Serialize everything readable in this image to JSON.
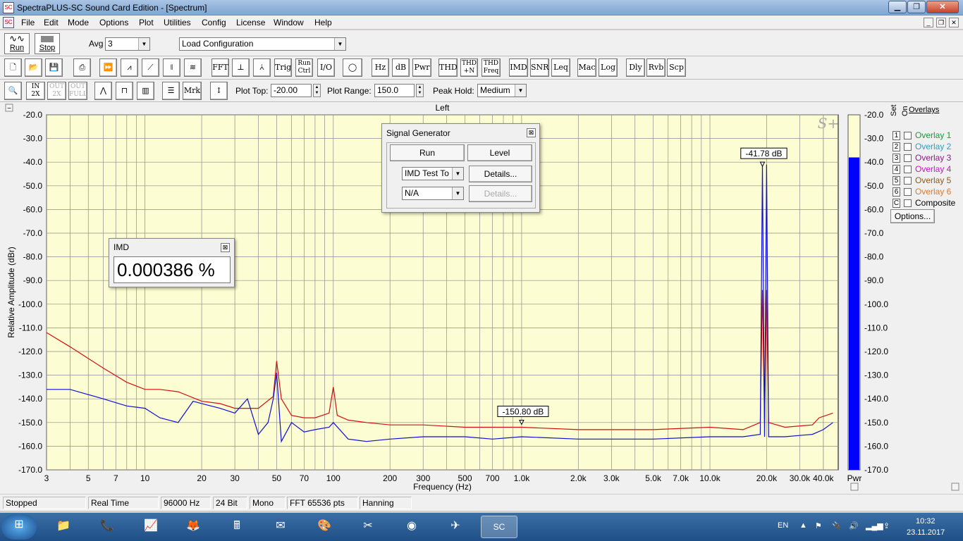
{
  "window": {
    "title": "SpectraPLUS-SC Sound Card Edition - [Spectrum]",
    "app_icon": "spectraplus-icon",
    "controls": [
      "minimize",
      "restore",
      "close"
    ]
  },
  "menu": {
    "items": [
      "File",
      "Edit",
      "Mode",
      "Options",
      "Plot",
      "Utilities",
      "Config",
      "License",
      "Window",
      "Help"
    ]
  },
  "toolbar1": {
    "run_label": "Run",
    "stop_label": "Stop",
    "avg_label": "Avg",
    "avg_value": "3",
    "config_value": "Load Configuration"
  },
  "toolbar2": {
    "buttons": [
      "FFT",
      "Trig",
      "Run Ctrl",
      "I/O",
      "Hz",
      "dB",
      "Pwr",
      "THD",
      "THD +N",
      "THD Freq",
      "IMD",
      "SNR",
      "Leq",
      "Mac",
      "Log",
      "Dly",
      "Rvb",
      "Scp"
    ]
  },
  "toolbar3": {
    "zoom_in": "IN 2X",
    "zoom_out": "OUT 2X",
    "zoom_full": "OUT FULL",
    "mrk": "Mrk",
    "plot_top_label": "Plot Top:",
    "plot_top_value": "-20.00",
    "plot_range_label": "Plot Range:",
    "plot_range_value": "150.0",
    "peak_hold_label": "Peak Hold:",
    "peak_hold_value": "Medium"
  },
  "plot": {
    "channel_title": "Left",
    "logo": "S+",
    "marker1": "-41.78 dB",
    "marker2": "-150.80 dB",
    "pwr_label": "Pwr"
  },
  "chart_data": {
    "type": "line",
    "title": "Left",
    "xlabel": "Frequency (Hz)",
    "ylabel": "Relative Amplitude (dBr)",
    "xscale": "log",
    "xlim": [
      3,
      48000
    ],
    "ylim": [
      -170,
      -20
    ],
    "x_tick_labels": [
      "3",
      "5",
      "7",
      "10",
      "20",
      "30",
      "50",
      "70",
      "100",
      "200",
      "300",
      "500",
      "700",
      "1.0k",
      "2.0k",
      "3.0k",
      "5.0k",
      "7.0k",
      "10.0k",
      "20.0k",
      "30.0k",
      "40.0k"
    ],
    "x_tick_values": [
      3,
      5,
      7,
      10,
      20,
      30,
      50,
      70,
      100,
      200,
      300,
      500,
      700,
      1000,
      2000,
      3000,
      5000,
      7000,
      10000,
      20000,
      30000,
      40000
    ],
    "y_tick_labels": [
      "-20.0",
      "-30.0",
      "-40.0",
      "-50.0",
      "-60.0",
      "-70.0",
      "-80.0",
      "-90.0",
      "-100.0",
      "-110.0",
      "-120.0",
      "-130.0",
      "-140.0",
      "-150.0",
      "-160.0",
      "-170.0"
    ],
    "grid": true,
    "series": [
      {
        "color": "#d01010",
        "x": [
          3,
          4,
          6,
          8,
          10,
          12,
          15,
          20,
          25,
          30,
          40,
          48,
          50,
          53,
          60,
          70,
          80,
          95,
          100,
          105,
          120,
          150,
          200,
          300,
          500,
          700,
          1000,
          2000,
          3000,
          5000,
          10000,
          15000,
          18500,
          19000,
          19500,
          20000,
          20500,
          25000,
          35000,
          38000,
          45000
        ],
        "y": [
          -112,
          -118,
          -127,
          -133,
          -136,
          -136,
          -137,
          -141,
          -142,
          -144,
          -144,
          -139,
          -124,
          -140,
          -147,
          -148,
          -148,
          -146,
          -135,
          -147,
          -149,
          -150,
          -151,
          -151,
          -152,
          -152,
          -152,
          -153,
          -153,
          -153,
          -152,
          -153,
          -150,
          -94,
          -150,
          -94,
          -150,
          -152,
          -151,
          -148,
          -146
        ]
      },
      {
        "color": "#1010d0",
        "x": [
          3,
          4,
          6,
          8,
          10,
          12,
          15,
          18,
          20,
          25,
          30,
          35,
          40,
          45,
          48,
          50,
          53,
          60,
          70,
          80,
          95,
          100,
          120,
          150,
          200,
          300,
          500,
          700,
          1000,
          2000,
          3000,
          5000,
          10000,
          15000,
          18500,
          19000,
          19500,
          20000,
          20500,
          25000,
          35000,
          40000,
          45000
        ],
        "y": [
          -136,
          -136,
          -140,
          -143,
          -144,
          -148,
          -150,
          -141,
          -142,
          -144,
          -146,
          -140,
          -155,
          -150,
          -140,
          -129,
          -158,
          -150,
          -154,
          -153,
          -152,
          -150,
          -157,
          -158,
          -157,
          -156,
          -156,
          -157,
          -156,
          -157,
          -157,
          -157,
          -156,
          -156,
          -155,
          -41,
          -156,
          -41,
          -156,
          -156,
          -155,
          -153,
          -150
        ]
      }
    ]
  },
  "pwr_meter": {
    "labels": [
      "-20.0",
      "-30.0",
      "-40.0",
      "-50.0",
      "-60.0",
      "-70.0",
      "-80.0",
      "-90.0",
      "-100.0",
      "-110.0",
      "-120.0",
      "-130.0",
      "-140.0",
      "-150.0",
      "-160.0",
      "-170.0"
    ],
    "level_db": -38
  },
  "overlays": {
    "title": "Overlays",
    "set_label": "Set",
    "on_label": "On",
    "items": [
      {
        "num": "1",
        "name": "Overlay 1",
        "color": "#1a9a3a"
      },
      {
        "num": "2",
        "name": "Overlay 2",
        "color": "#2aa0c0"
      },
      {
        "num": "3",
        "name": "Overlay 3",
        "color": "#8a1a8a"
      },
      {
        "num": "4",
        "name": "Overlay 4",
        "color": "#d010d0"
      },
      {
        "num": "5",
        "name": "Overlay 5",
        "color": "#8a5a1a"
      },
      {
        "num": "6",
        "name": "Overlay 6",
        "color": "#e07a2a"
      },
      {
        "num": "C",
        "name": "Composite",
        "color": "#000000"
      }
    ],
    "options_label": "Options..."
  },
  "imd_dialog": {
    "title": "IMD",
    "value": "0.000386 %"
  },
  "siggen_dialog": {
    "title": "Signal Generator",
    "run_label": "Run",
    "level_label": "Level",
    "mode_value": "IMD Test To",
    "details1_label": "Details...",
    "na_value": "N/A",
    "details2_label": "Details..."
  },
  "status": {
    "cells": [
      "Stopped",
      "Real Time",
      "96000 Hz",
      "24 Bit",
      "Mono",
      "FFT 65536 pts",
      "Hanning"
    ]
  },
  "taskbar": {
    "lang": "EN",
    "time": "10:32",
    "date": "23.11.2017"
  }
}
